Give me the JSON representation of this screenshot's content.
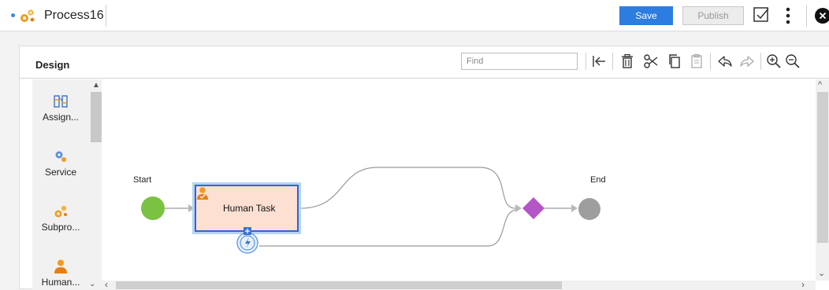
{
  "header": {
    "process_name": "Process16",
    "save_label": "Save",
    "publish_label": "Publish",
    "accent_color": "#2d7de0"
  },
  "design": {
    "title": "Design",
    "find_placeholder": "Find",
    "toolbar_icons": [
      "go-to-start-icon",
      "delete-icon",
      "cut-icon",
      "copy-icon",
      "paste-icon",
      "undo-icon",
      "redo-icon",
      "zoom-in-icon",
      "zoom-out-icon"
    ]
  },
  "palette": {
    "items": [
      {
        "label": "Assign...",
        "icon": "assignment-icon"
      },
      {
        "label": "Service",
        "icon": "service-icon"
      },
      {
        "label": "Subpro...",
        "icon": "subprocess-icon"
      },
      {
        "label": "Human...",
        "icon": "human-task-icon"
      }
    ]
  },
  "canvas": {
    "start_label": "Start",
    "end_label": "End",
    "task_label": "Human Task",
    "colors": {
      "start": "#7cc242",
      "end": "#9e9e9e",
      "gateway": "#b357c6",
      "task_fill": "#fde0d2",
      "task_border": "#2f64d8"
    }
  }
}
